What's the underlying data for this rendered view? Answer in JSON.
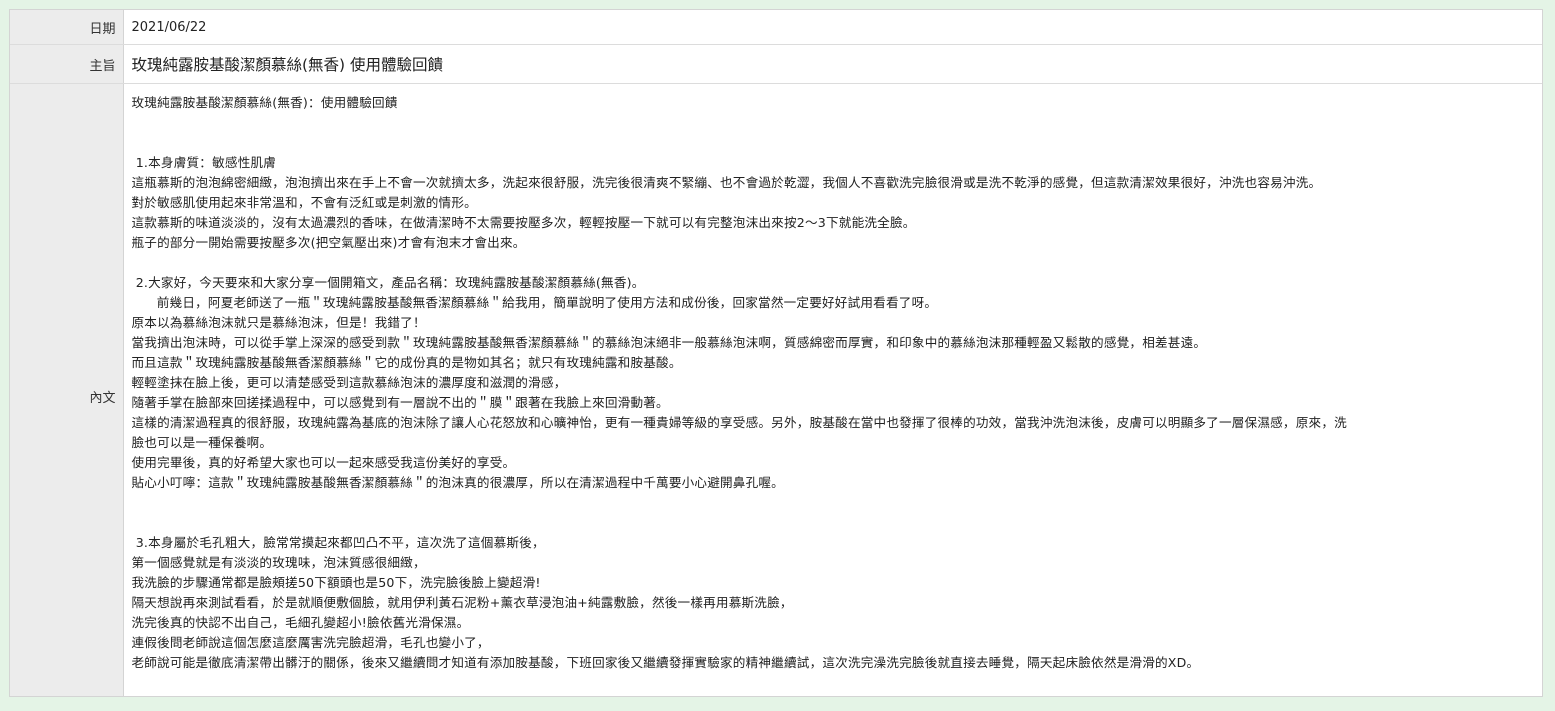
{
  "labels": {
    "date": "日期",
    "subject": "主旨",
    "content": "內文"
  },
  "date": "2021/06/22",
  "subject": "玫瑰純露胺基酸潔顏慕絲(無香) 使用體驗回饋",
  "content_lines": [
    "玫瑰純露胺基酸潔顏慕絲(無香)：使用體驗回饋",
    "",
    "",
    " 1.本身膚質：敏感性肌膚",
    "這瓶慕斯的泡泡綿密細緻，泡泡擠出來在手上不會一次就擠太多，洗起來很舒服，洗完後很清爽不緊繃、也不會過於乾澀，我個人不喜歡洗完臉很滑或是洗不乾淨的感覺，但這款清潔效果很好，沖洗也容易沖洗。",
    "對於敏感肌使用起來非常溫和，不會有泛紅或是刺激的情形。",
    "這款慕斯的味道淡淡的，沒有太過濃烈的香味，在做清潔時不太需要按壓多次，輕輕按壓一下就可以有完整泡沫出來按2～3下就能洗全臉。",
    "瓶子的部分一開始需要按壓多次(把空氣壓出來)才會有泡末才會出來。",
    "",
    " 2.大家好，今天要來和大家分享一個開箱文，產品名稱：玫瑰純露胺基酸潔顏慕絲(無香)。",
    "      前幾日，阿夏老師送了一瓶＂玫瑰純露胺基酸無香潔顏慕絲＂給我用，簡單說明了使用方法和成份後，回家當然一定要好好試用看看了呀。",
    "原本以為慕絲泡沫就只是慕絲泡沫，但是！我錯了！",
    "當我擠出泡沫時，可以從手掌上深深的感受到款＂玫瑰純露胺基酸無香潔顏慕絲＂的慕絲泡沫絕非一般慕絲泡沫啊，質感綿密而厚實，和印象中的慕絲泡沫那種輕盈又鬆散的感覺，相差甚遠。",
    "而且這款＂玫瑰純露胺基酸無香潔顏慕絲＂它的成份真的是物如其名；就只有玫瑰純露和胺基酸。",
    "輕輕塗抹在臉上後，更可以清楚感受到這款慕絲泡沫的濃厚度和滋潤的滑感，",
    "隨著手掌在臉部來回搓揉過程中，可以感覺到有一層說不出的＂膜＂跟著在我臉上來回滑動著。",
    "這樣的清潔過程真的很舒服，玫瑰純露為基底的泡沫除了讓人心花怒放和心曠神怡，更有一種貴婦等級的享受感。另外，胺基酸在當中也發揮了很棒的功效，當我沖洗泡沫後，皮膚可以明顯多了一層保濕感，原來，洗",
    "臉也可以是一種保養啊。",
    "使用完畢後，真的好希望大家也可以一起來感受我這份美好的享受。",
    "貼心小叮嚀：這款＂玫瑰純露胺基酸無香潔顏慕絲＂的泡沫真的很濃厚，所以在清潔過程中千萬要小心避開鼻孔喔。",
    "",
    "",
    " 3.本身屬於毛孔粗大，臉常常摸起來都凹凸不平，這次洗了這個慕斯後，",
    "第一個感覺就是有淡淡的玫瑰味，泡沫質感很細緻，",
    "我洗臉的步驟通常都是臉頰搓50下額頭也是50下，洗完臉後臉上變超滑!",
    "隔天想說再來測試看看，於是就順便敷個臉，就用伊利黃石泥粉+薰衣草浸泡油+純露敷臉，然後一樣再用慕斯洗臉，",
    "洗完後真的快認不出自己，毛細孔變超小!臉依舊光滑保濕。",
    "連假後問老師說這個怎麼這麼厲害洗完臉超滑，毛孔也變小了，",
    "老師說可能是徹底清潔帶出髒汙的關係，後來又繼續問才知道有添加胺基酸，下班回家後又繼續發揮實驗家的精神繼續試，這次洗完澡洗完臉後就直接去睡覺，隔天起床臉依然是滑滑的XD。"
  ]
}
